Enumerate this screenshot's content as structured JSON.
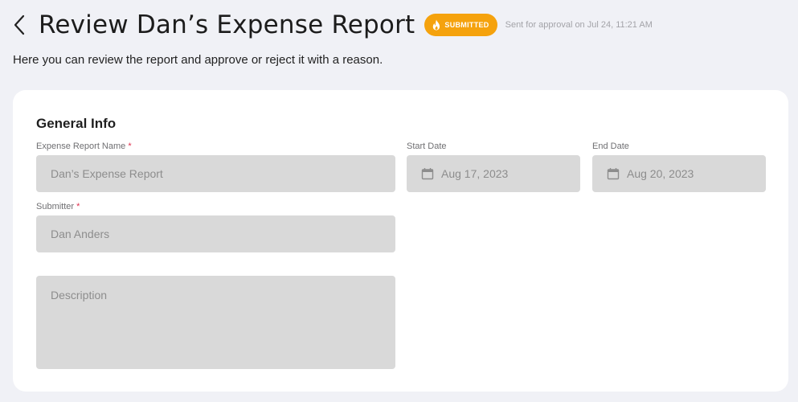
{
  "header": {
    "title": "Review Dan’s Expense Report",
    "status_badge": "SUBMITTED",
    "status_meta": "Sent for approval on Jul 24, 11:21 AM"
  },
  "subtitle": "Here you can review the report and approve or reject it with a reason.",
  "general_info": {
    "title": "General Info",
    "report_name": {
      "label": "Expense Report Name",
      "required_mark": "*",
      "value": "Dan’s Expense Report"
    },
    "start_date": {
      "label": "Start Date",
      "value": "Aug 17, 2023"
    },
    "end_date": {
      "label": "End Date",
      "value": "Aug 20, 2023"
    },
    "submitter": {
      "label": "Submitter",
      "required_mark": "*",
      "value": "Dan Anders"
    },
    "description": {
      "placeholder": "Description"
    }
  },
  "colors": {
    "badge": "#f5a20d",
    "required": "#e0304e",
    "field_bg": "#d9d9d9",
    "page_bg": "#f0f1f6"
  },
  "icons": {
    "back": "chevron-left-icon",
    "badge": "flame-icon",
    "date": "calendar-icon"
  }
}
